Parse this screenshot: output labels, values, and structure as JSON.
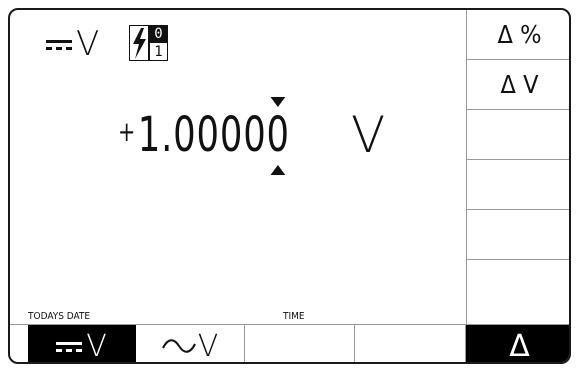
{
  "header": {
    "mode_unit": "V",
    "status_bits": {
      "top": "0",
      "bottom": "1"
    }
  },
  "reading": {
    "sign": "+",
    "digits_before_cursor": "1.0000",
    "cursor_digit": "0",
    "unit": "V"
  },
  "softkeys": [
    {
      "label": "Δ %"
    },
    {
      "label": "Δ V"
    },
    {
      "label": ""
    },
    {
      "label": ""
    },
    {
      "label": ""
    },
    {
      "label": ""
    }
  ],
  "status_strip": {
    "date_label": "TODAYS DATE",
    "time_label": "TIME"
  },
  "function_keys": [
    {
      "label": "V",
      "glyph": "dc-icon",
      "active": true
    },
    {
      "label": "V",
      "glyph": "ac-wave-icon",
      "active": false
    },
    {
      "label": "",
      "active": false
    },
    {
      "label": "",
      "active": false
    },
    {
      "label": "Δ",
      "active": true
    }
  ]
}
